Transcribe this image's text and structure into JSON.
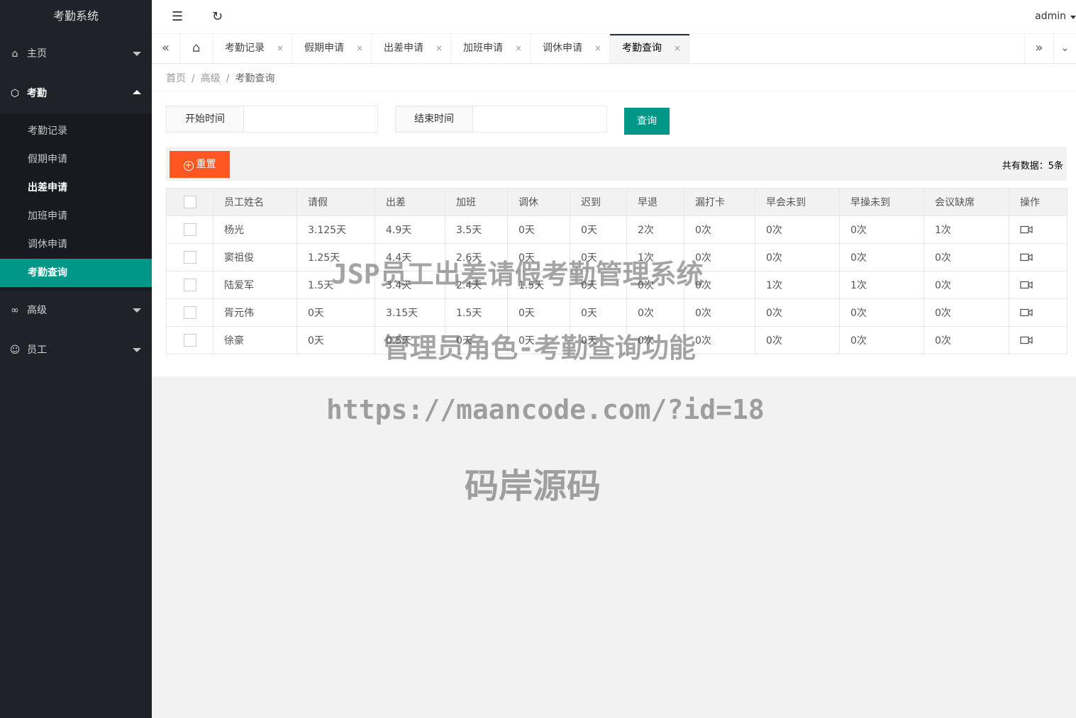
{
  "app_title": "考勤系统",
  "header": {
    "user": "admin"
  },
  "nav": {
    "home": "主页",
    "attendance": "考勤",
    "attendance_items": [
      "考勤记录",
      "假期申请",
      "出差申请",
      "加班申请",
      "调休申请",
      "考勤查询"
    ],
    "advanced": "高级",
    "staff": "员工"
  },
  "tabs": [
    "考勤记录",
    "假期申请",
    "出差申请",
    "加班申请",
    "调休申请",
    "考勤查询"
  ],
  "tab_close": "×",
  "breadcrumb": {
    "home": "首页",
    "parent": "高级",
    "current": "考勤查询",
    "sep": "/"
  },
  "search": {
    "start_label": "开始时间",
    "start_value": "",
    "end_label": "结束时间",
    "end_value": "",
    "query_label": "查询"
  },
  "toolbar": {
    "reset_label": "重置",
    "total": "共有数据：5条"
  },
  "table": {
    "columns": [
      "员工姓名",
      "请假",
      "出差",
      "加班",
      "调休",
      "迟到",
      "早退",
      "漏打卡",
      "早会未到",
      "早操未到",
      "会议缺席",
      "操作"
    ],
    "rows": [
      [
        "杨光",
        "3.125天",
        "4.9天",
        "3.5天",
        "0天",
        "0天",
        "2次",
        "0次",
        "0次",
        "0次",
        "1次"
      ],
      [
        "窦祖俊",
        "1.25天",
        "4.4天",
        "2.6天",
        "0天",
        "0天",
        "1次",
        "0次",
        "0次",
        "0次",
        "0次"
      ],
      [
        "陆爱军",
        "1.5天",
        "3.4天",
        "2.4天",
        "1.5天",
        "0天",
        "0次",
        "0次",
        "1次",
        "1次",
        "0次"
      ],
      [
        "胥元伟",
        "0天",
        "3.15天",
        "1.5天",
        "0天",
        "0天",
        "0次",
        "0次",
        "0次",
        "0次",
        "0次"
      ],
      [
        "徐豪",
        "0天",
        "0.5天",
        "0天",
        "0天",
        "0天",
        "0次",
        "0次",
        "0次",
        "0次",
        "0次"
      ]
    ]
  },
  "watermark": {
    "line1": "JSP员工出差请假考勤管理系统",
    "line2": "管理员角色-考勤查询功能",
    "line3": "https://maancode.com/?id=18",
    "line4": "码岸源码"
  },
  "colors": {
    "sidebar": "#20222a",
    "accent": "#009688",
    "reset": "#ff5722"
  }
}
